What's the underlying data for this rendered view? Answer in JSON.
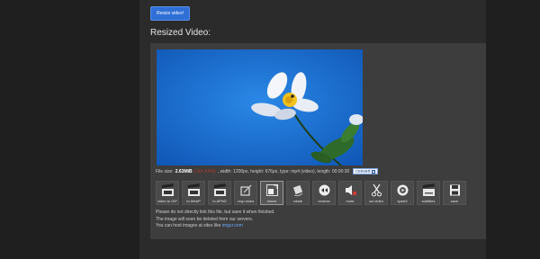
{
  "resize_button": "Resize video!",
  "heading": "Resized Video:",
  "file_info": {
    "prefix": "File size:",
    "size": "2.63MiB",
    "percent": "(-XX.XX%)",
    "details": ", width: 1200px, height: 676px, type: mp4 (video), length: 00:00:30",
    "convert_label": "convert"
  },
  "tools": [
    {
      "label": "video to GIF",
      "icon": "clapperboard-icon"
    },
    {
      "label": "to WebP",
      "icon": "clapperboard-icon"
    },
    {
      "label": "to APNG",
      "icon": "clapperboard-icon"
    },
    {
      "label": "crop video",
      "icon": "crop-icon"
    },
    {
      "label": "resize",
      "icon": "resize-icon"
    },
    {
      "label": "rotate",
      "icon": "rotate-icon"
    },
    {
      "label": "reverse",
      "icon": "reverse-icon"
    },
    {
      "label": "mute",
      "icon": "mute-icon"
    },
    {
      "label": "cut video",
      "icon": "scissors-icon"
    },
    {
      "label": "speed",
      "icon": "speed-icon"
    },
    {
      "label": "subtitles",
      "icon": "subtitles-icon"
    },
    {
      "label": "save",
      "icon": "save-icon"
    }
  ],
  "notes": {
    "line1": "Please do not directly link this file, but save it when finished.",
    "line2": "The image will soon be deleted from our servers.",
    "line3_prefix": "You can host images at sites like",
    "line3_link": "imgur.com"
  }
}
